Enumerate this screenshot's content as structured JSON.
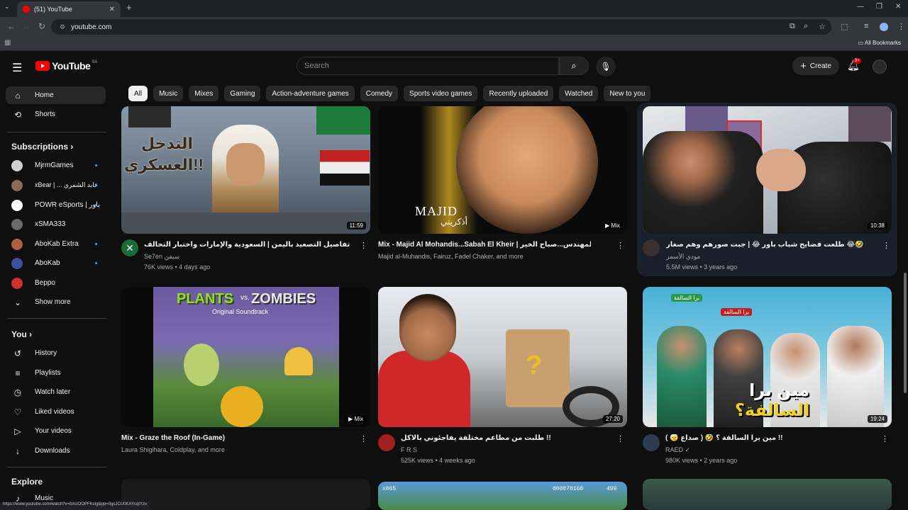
{
  "browser": {
    "tab_title": "(51) YouTube",
    "url": "youtube.com",
    "all_bookmarks": "All Bookmarks",
    "status_url": "https://www.youtube.com/watch?v=0AUOOPFKsIg&pp=0gcJCU0KAYcqIYzv"
  },
  "header": {
    "logo_text": "YouTube",
    "country_code": "SA",
    "search_placeholder": "Search",
    "create_label": "Create",
    "notifications_badge": "9+"
  },
  "sidebar": {
    "main": [
      {
        "label": "Home",
        "icon": "home-icon",
        "glyph": "⌂"
      },
      {
        "label": "Shorts",
        "icon": "shorts-icon",
        "glyph": "⟲"
      }
    ],
    "subscriptions_heading": "Subscriptions",
    "subscriptions": [
      {
        "label": "MjrmGames",
        "color": "#d0d0d0",
        "dot": true
      },
      {
        "label": "xBear | ... عابد الشمري",
        "color": "#8a6a55",
        "dot": true
      },
      {
        "label": "POWR eSports | باور",
        "color": "#ffffff",
        "dot": true
      },
      {
        "label": "xSMA333",
        "color": "#6a6a6a",
        "dot": false
      },
      {
        "label": "AboKab Extra",
        "color": "#b06040",
        "dot": true
      },
      {
        "label": "AboKab",
        "color": "#4050a0",
        "dot": true
      },
      {
        "label": "Beppo",
        "color": "#d03030",
        "dot": false
      }
    ],
    "show_more": "Show more",
    "you_heading": "You",
    "you_items": [
      {
        "label": "History",
        "icon": "history-icon",
        "glyph": "↺"
      },
      {
        "label": "Playlists",
        "icon": "playlists-icon",
        "glyph": "≡"
      },
      {
        "label": "Watch later",
        "icon": "watch-later-icon",
        "glyph": "◷"
      },
      {
        "label": "Liked videos",
        "icon": "liked-videos-icon",
        "glyph": "♡"
      },
      {
        "label": "Your videos",
        "icon": "your-videos-icon",
        "glyph": "▷"
      },
      {
        "label": "Downloads",
        "icon": "downloads-icon",
        "glyph": "↓"
      }
    ],
    "explore_heading": "Explore",
    "explore_items": [
      {
        "label": "Music",
        "icon": "music-icon",
        "glyph": "♪"
      }
    ]
  },
  "chips": [
    "All",
    "Music",
    "Mixes",
    "Gaming",
    "Action-adventure games",
    "Comedy",
    "Sports video games",
    "Recently uploaded",
    "Watched",
    "New to you"
  ],
  "videos": [
    {
      "title": "تفاصيل التصعيد باليمن | السعودية والإمارات واختبار التحالف",
      "channel": "Se7en سيفن",
      "meta": "76K views • 4 days ago",
      "duration": "11:59",
      "mix": false,
      "avatar_color": "#1a6a3a"
    },
    {
      "title": "Mix - Majid Al Mohandis...Sabah El Kheir | ماجد المهندس...صباح الخير",
      "channel": "Majid al-Muhandis, Fairuz, Fadel Chaker, and more",
      "meta": "",
      "duration": "Mix",
      "mix": true,
      "avatar_color": ""
    },
    {
      "title": "طلعت فضايح شباب باور 😂 | جبت صورهم وهم صغار 😂🤣",
      "channel": "مودي الأسمر",
      "meta": "5.5M views • 3 years ago",
      "duration": "10:38",
      "mix": false,
      "avatar_color": "#3a3030"
    },
    {
      "title": "Mix - Graze the Roof (In-Game)",
      "channel": "Laura Shigihara, Coldplay, and more",
      "meta": "",
      "duration": "Mix",
      "mix": true,
      "avatar_color": ""
    },
    {
      "title": "طلبت من مطاعم مختلفة يفاجئوني بالاكل !!",
      "channel": "F R S",
      "meta": "525K views • 4 weeks ago",
      "duration": "27:20",
      "mix": false,
      "avatar_color": "#a02020"
    },
    {
      "title": "مين برا السالفة ؟ 🤣 ( صداع 🤕 ) !!",
      "channel": "RAED",
      "meta": "980K views • 2 years ago",
      "duration": "19:24",
      "mix": false,
      "avatar_color": "#303a50"
    }
  ],
  "thumb_text": {
    "v1_line1": "التدخل",
    "v1_line2": "العسكري!!",
    "v2_name": "MAJID",
    "v2_sub": "أذكريني",
    "v4_plants": "PLANTS",
    "v4_vs": "vs.",
    "v4_zombies": "ZOMBIES",
    "v4_sub": "Original Soundtrack",
    "v5_badge": "?",
    "v6_line1": "مين برا",
    "v6_line2": "السالفة؟",
    "v6_tag": "برا السالفة",
    "v7_score": "000070160",
    "v7_coins": "499",
    "v7_counter": "x065"
  }
}
